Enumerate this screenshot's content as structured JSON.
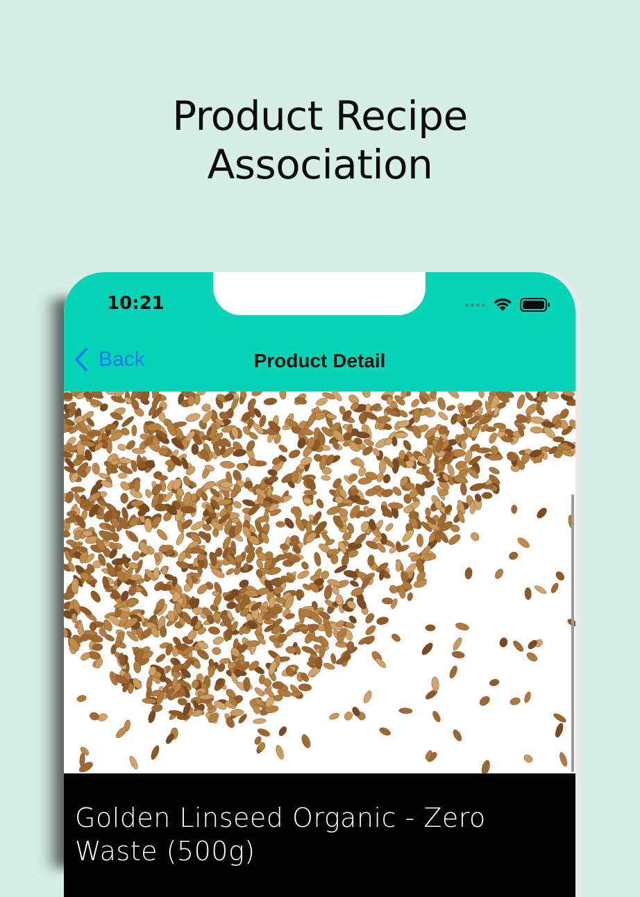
{
  "headline": {
    "line1": "Product Recipe",
    "line2": "Association"
  },
  "status_bar": {
    "time": "10:21",
    "icons": [
      "signal-icon",
      "wifi-icon",
      "battery-icon"
    ]
  },
  "nav": {
    "back_label": "Back",
    "title": "Product Detail"
  },
  "product": {
    "image": "linseed-seeds-image",
    "name": "Golden Linseed Organic - Zero Waste (500g)"
  },
  "colors": {
    "background": "#d5efe5",
    "accent": "#05d5b6",
    "link": "#1a7bf0",
    "info_bar": "#030303"
  }
}
